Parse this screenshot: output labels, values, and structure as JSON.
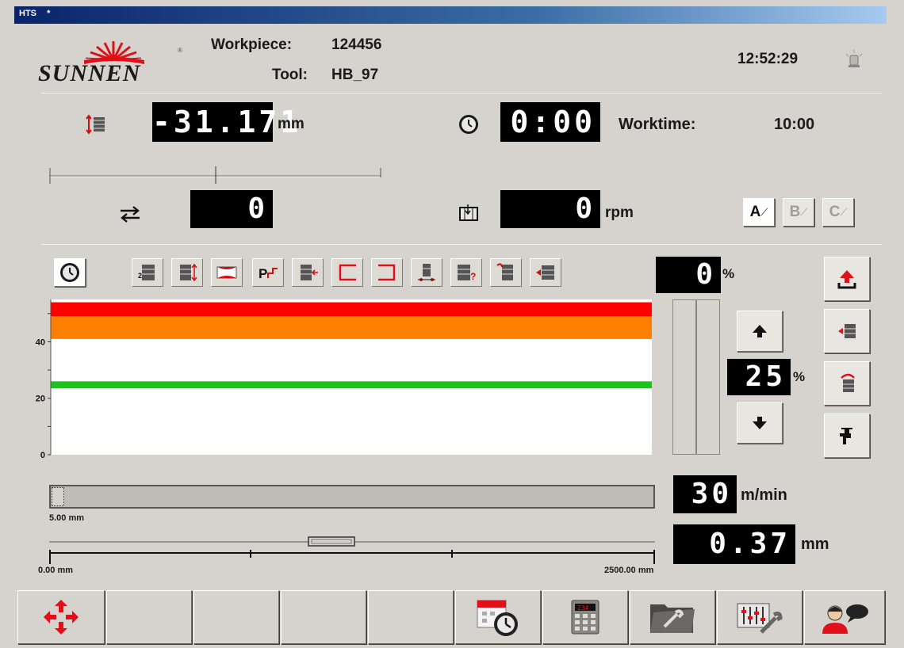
{
  "window": {
    "title": "HTS"
  },
  "header": {
    "brand": "SUNNEN",
    "workpiece_label": "Workpiece:",
    "workpiece_value": "124456",
    "tool_label": "Tool:",
    "tool_value": "HB_97",
    "clock": "12:52:29"
  },
  "readouts": {
    "position": {
      "value": "-31.171",
      "unit": "mm"
    },
    "timer": {
      "value": "0:00"
    },
    "worktime": {
      "label": "Worktime:",
      "value": "10:00"
    },
    "stroke": {
      "value": "0"
    },
    "spindle": {
      "value": "0",
      "unit": "rpm"
    },
    "abc_buttons": [
      "A",
      "B",
      "C"
    ],
    "percent_top": {
      "value": "0",
      "unit": "%"
    },
    "override": {
      "value": "25",
      "unit": "%"
    },
    "speed": {
      "value": "30",
      "unit": "m/min"
    },
    "feed": {
      "value": "0.37",
      "unit": "mm"
    }
  },
  "chart_data": {
    "type": "bar",
    "ylim": [
      0,
      55
    ],
    "yticks": [
      "0",
      "20",
      "40"
    ],
    "bands": [
      {
        "name": "red",
        "from": 49,
        "to": 54,
        "color": "#ff0000"
      },
      {
        "name": "orange",
        "from": 41,
        "to": 49,
        "color": "#ff8000"
      },
      {
        "name": "green",
        "from": 23.5,
        "to": 26,
        "color": "#1bc41b"
      }
    ]
  },
  "progress": {
    "length_label": "5.00 mm",
    "scale_min": "0.00 mm",
    "scale_max": "2500.00 mm"
  },
  "colors": {
    "background": "#d6d3ce",
    "lcd": "#000000",
    "accent_red": "#e0101a"
  },
  "icons": {
    "toolbar": [
      "clock-icon",
      "cycle-2-icon",
      "cycle-spread-icon",
      "honing-icon",
      "park-icon",
      "feed-in-icon",
      "bracket-left-icon",
      "bracket-right-icon",
      "tool-measure-icon",
      "tool-query-icon",
      "tool-return-icon",
      "tool-advance-icon"
    ],
    "footer": [
      "cycle-arrows-icon",
      "calendar-clock-icon",
      "calculator-icon",
      "tool-folder-icon",
      "settings-tools-icon",
      "operator-chat-icon"
    ]
  }
}
